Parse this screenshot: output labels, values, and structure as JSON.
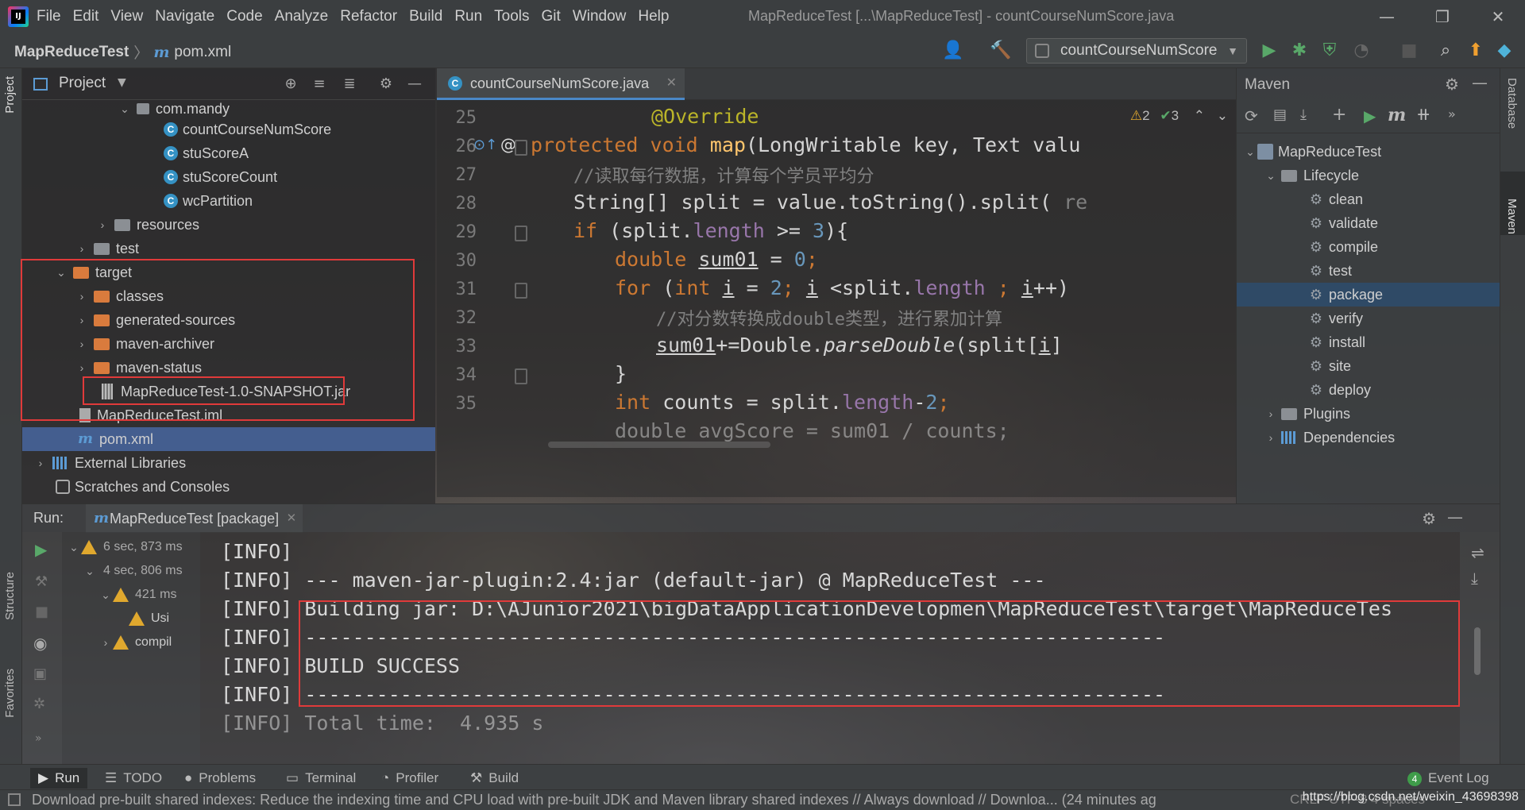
{
  "menu": {
    "items": [
      "File",
      "Edit",
      "View",
      "Navigate",
      "Code",
      "Analyze",
      "Refactor",
      "Build",
      "Run",
      "Tools",
      "Git",
      "Window",
      "Help"
    ],
    "window_title": "MapReduceTest [...\\MapReduceTest] - countCourseNumScore.java"
  },
  "breadcrumb": {
    "project": "MapReduceTest",
    "file": "pom.xml"
  },
  "run_config": {
    "label": "countCourseNumScore"
  },
  "project_panel": {
    "title": "Project",
    "tree": {
      "package": "com.mandy",
      "classes": [
        "countCourseNumScore",
        "stuScoreA",
        "stuScoreCount",
        "wcPartition"
      ],
      "resources": "resources",
      "test": "test",
      "target": "target",
      "target_children": [
        "classes",
        "generated-sources",
        "maven-archiver",
        "maven-status"
      ],
      "jar": "MapReduceTest-1.0-SNAPSHOT.jar",
      "iml": "MapReduceTest.iml",
      "pom": "pom.xml",
      "external_libraries": "External Libraries",
      "scratches": "Scratches and Consoles"
    }
  },
  "editor": {
    "tab_label": "countCourseNumScore.java",
    "inspections": {
      "warnings": "2",
      "ok": "3"
    },
    "line_numbers": [
      "25",
      "26",
      "27",
      "28",
      "29",
      "30",
      "31",
      "32",
      "33",
      "34",
      "35"
    ],
    "lines": {
      "l25": "@Override",
      "l26_kw": "protected void ",
      "l26_fn": "map",
      "l26_rest": "(LongWritable key, Text valu",
      "l27": "//读取每行数据，计算每个学员平均分",
      "l28_a": "String[] split = value.toString().split(",
      "l28_hint": " re",
      "l29_kw": "if ",
      "l29_a": "(split.",
      "l29_fld": "length",
      "l29_b": " >= ",
      "l29_num": "3",
      "l29_c": "){",
      "l30_kw": "double ",
      "l30_var": "sum01",
      "l30_b": " = ",
      "l30_num": "0",
      "l30_c": ";",
      "l31_kw": "for ",
      "l31_a": "(",
      "l31_kw2": "int ",
      "l31_var": "i",
      "l31_b": " = ",
      "l31_num": "2",
      "l31_c": "; ",
      "l31_var2": "i",
      "l31_d": " <split.",
      "l31_fld": "length",
      "l31_e": " ; ",
      "l31_var3": "i",
      "l31_f": "++)",
      "l32": "//对分数转换成double类型，进行累加计算",
      "l33_var": "sum01",
      "l33_a": "+=Double.",
      "l33_it": "parseDouble",
      "l33_b": "(split[",
      "l33_var2": "i",
      "l33_c": "]",
      "l34": "}",
      "l35_kw": "int ",
      "l35_a": "counts = split.",
      "l35_fld": "length",
      "l35_b": "-",
      "l35_num": "2",
      "l35_c": ";",
      "l36": "double avgScore = sum01 / counts;"
    }
  },
  "maven": {
    "title": "Maven",
    "project": "MapReduceTest",
    "lifecycle": "Lifecycle",
    "phases": [
      "clean",
      "validate",
      "compile",
      "test",
      "package",
      "verify",
      "install",
      "site",
      "deploy"
    ],
    "selected_phase": "package",
    "plugins": "Plugins",
    "dependencies": "Dependencies"
  },
  "side_tabs": {
    "project": "Project",
    "structure": "Structure",
    "favorites": "Favorites",
    "database": "Database",
    "maven": "Maven"
  },
  "run": {
    "label": "Run:",
    "tab": "MapReduceTest [package]",
    "tree": [
      {
        "text": "6 sec, 873 ms"
      },
      {
        "text": "4 sec, 806 ms"
      },
      {
        "text": "421 ms"
      },
      {
        "text": "Usi"
      },
      {
        "text": "compil"
      }
    ],
    "console": [
      "[INFO]",
      "[INFO] --- maven-jar-plugin:2.4:jar (default-jar) @ MapReduceTest ---",
      "[INFO] Building jar: D:\\AJunior2021\\bigDataApplicationDevelopmen\\MapReduceTest\\target\\MapReduceTes",
      "[INFO] ------------------------------------------------------------------------",
      "[INFO] BUILD SUCCESS",
      "[INFO] ------------------------------------------------------------------------",
      "[INFO] Total time:  4.935 s"
    ]
  },
  "bottom_bar": {
    "run": "Run",
    "todo": "TODO",
    "problems": "Problems",
    "terminal": "Terminal",
    "profiler": "Profiler",
    "build": "Build",
    "event_log_count": "4",
    "event_log": "Event Log"
  },
  "status": {
    "message": "Download pre-built shared indexes: Reduce the indexing time and CPU load with pre-built JDK and Maven library shared indexes // Always download // Downloa... (24 minutes ag",
    "right": "CRLF   UTF-8   4 spaces",
    "watermark": "https://blog.csdn.net/weixin_43698398"
  }
}
